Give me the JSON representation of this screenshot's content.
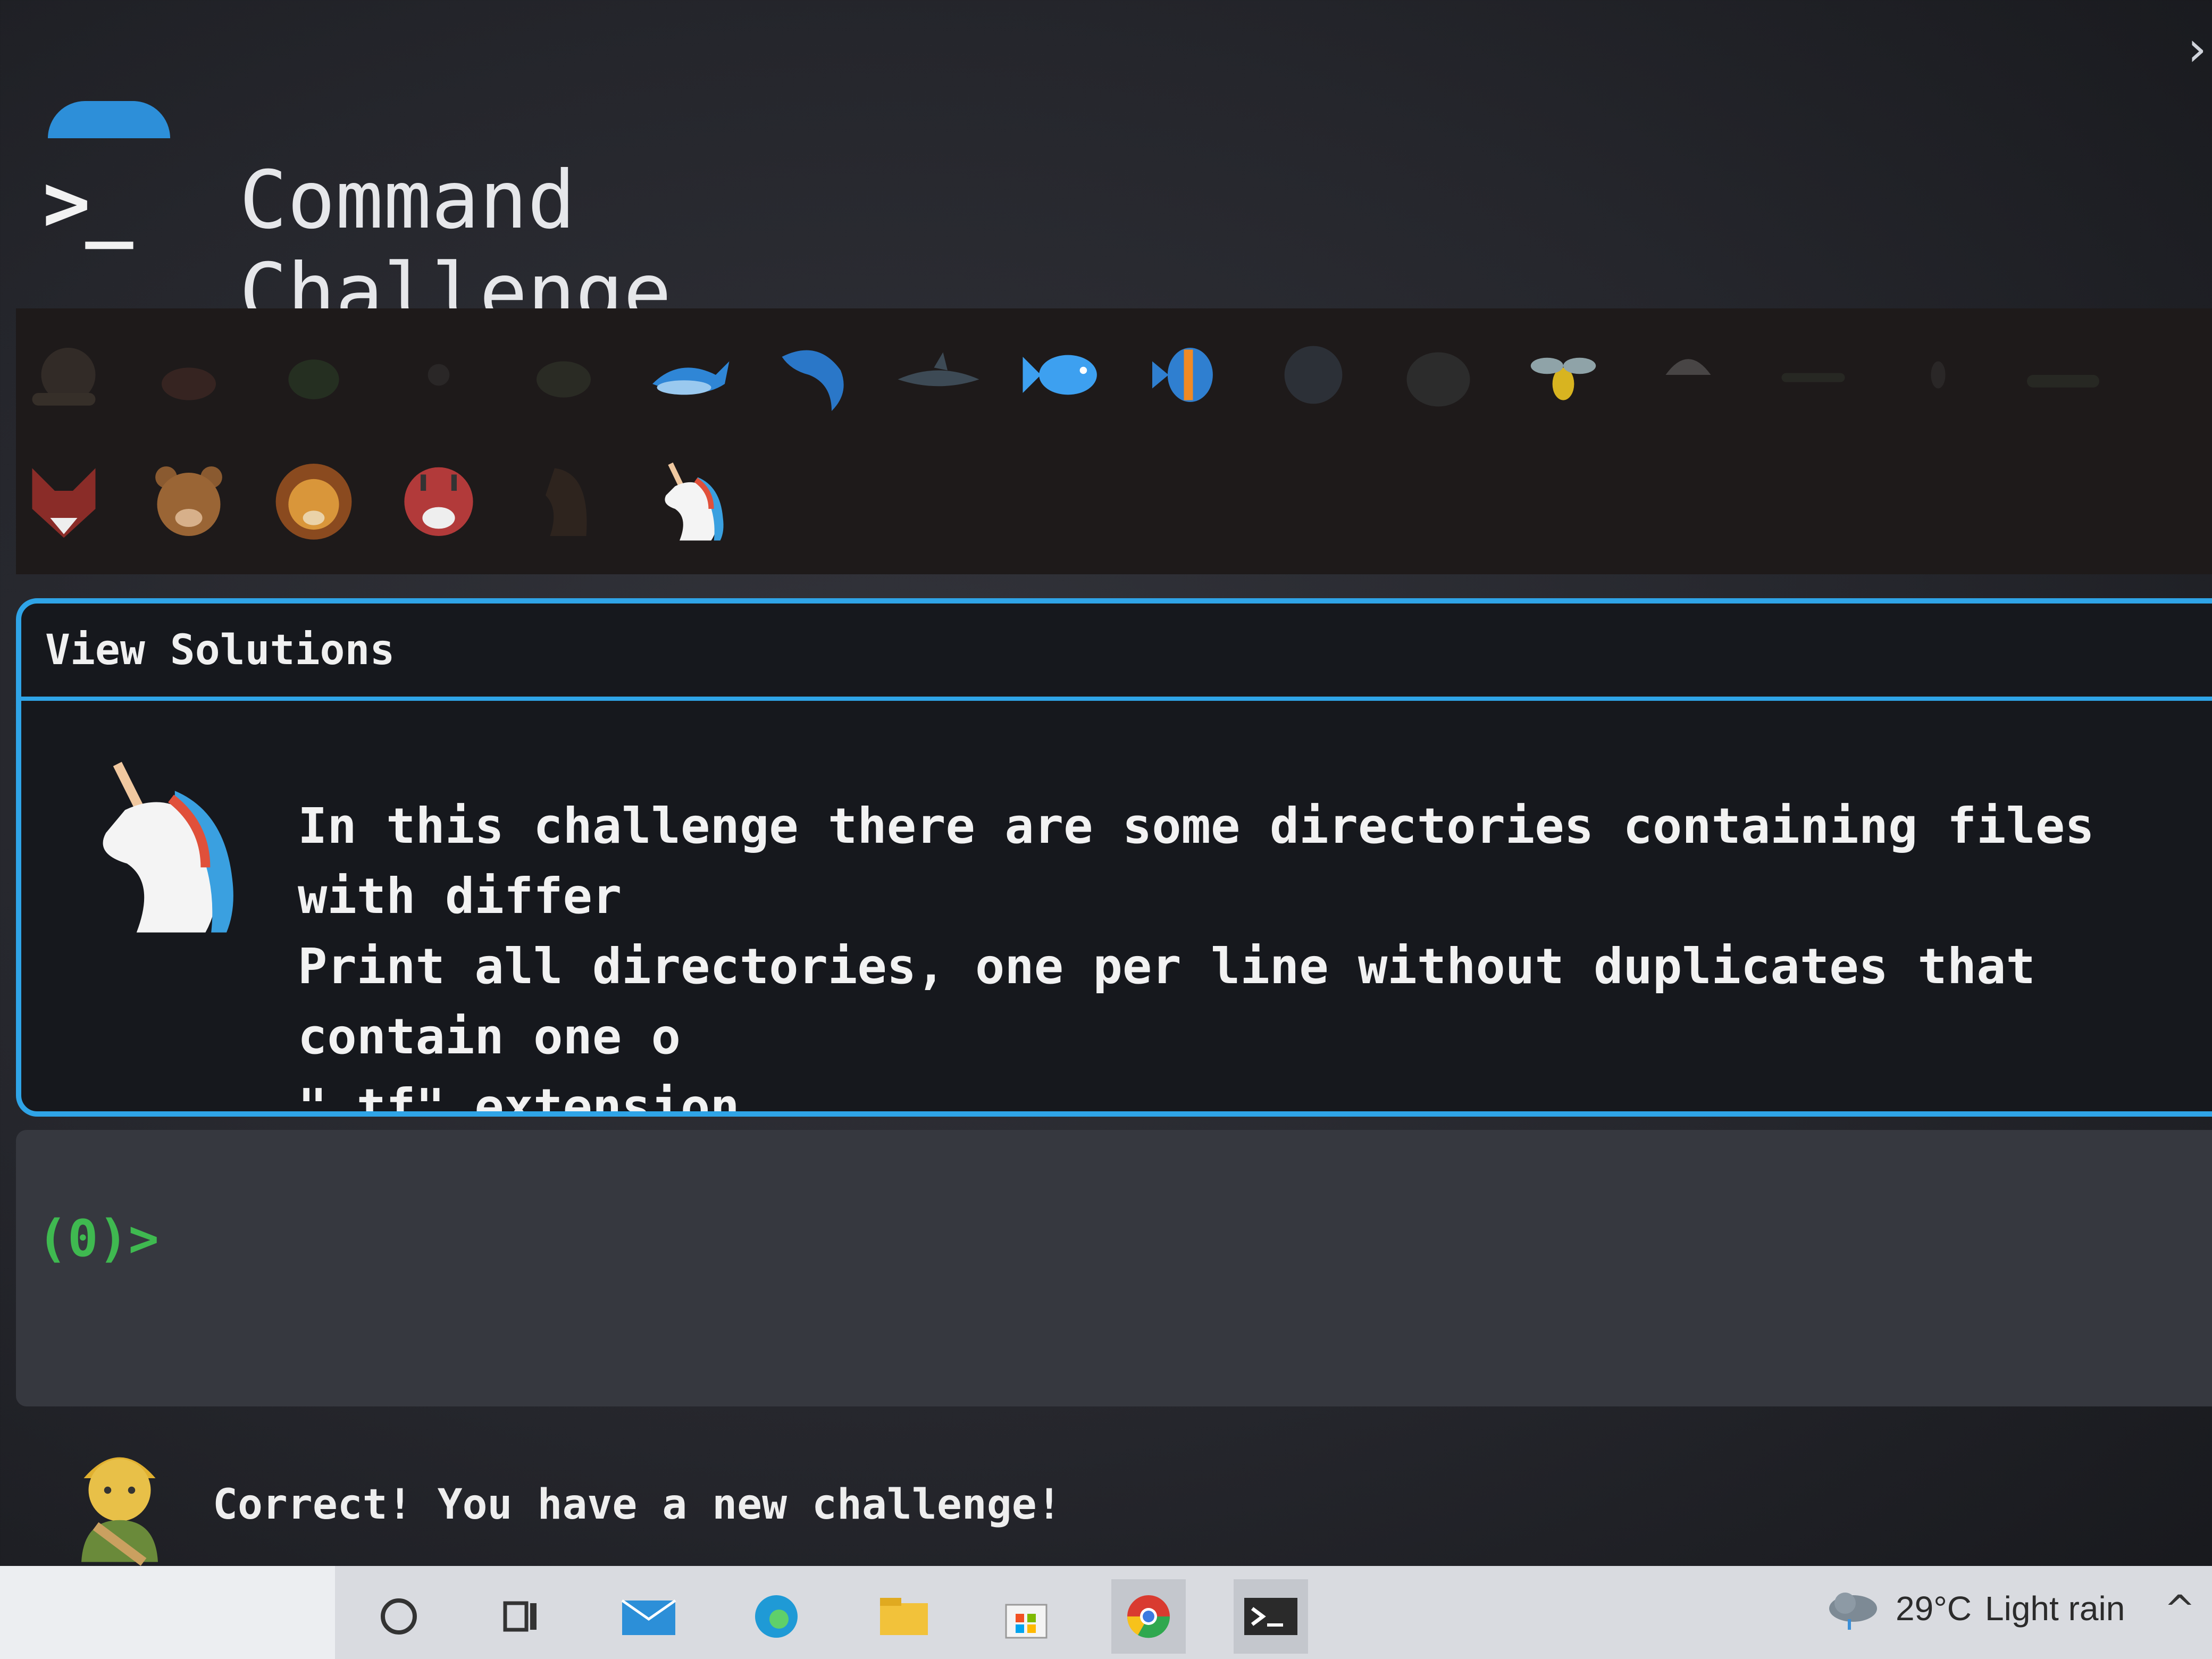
{
  "window": {
    "close_glyph": "›"
  },
  "header": {
    "logo_glyph": ">_",
    "title": "Command Challenge"
  },
  "emoji_strip": {
    "row1": [
      "snail",
      "crab",
      "frog",
      "ant",
      "turtle",
      "whale",
      "dolphin",
      "shark",
      "fish",
      "tropical-fish",
      "blowfish",
      "seal",
      "bee",
      "mushroom",
      "lizard",
      "bug",
      "crocodile"
    ],
    "row2": [
      "fox",
      "bear",
      "lion",
      "tiger",
      "horse",
      "unicorn"
    ],
    "completed_count_row1": 8,
    "completed_count_row2": 5
  },
  "panel": {
    "view_solutions": "View Solutions",
    "challenge_text": "In this challenge there are some directories containing files with differ\nPrint all directories, one per line without duplicates that contain one o\n\".tf\" extension."
  },
  "terminal": {
    "prompt": "(0)>",
    "input_value": ""
  },
  "feedback": {
    "message": "Correct! You have a new challenge!"
  },
  "taskbar": {
    "weather_temp": "29°C",
    "weather_desc": "Light rain",
    "overflow_glyph": "^",
    "icons": [
      "search-icon",
      "cortana-icon",
      "task-view-icon",
      "mail-icon",
      "edge-icon",
      "file-explorer-icon",
      "store-icon",
      "chrome-icon",
      "terminal-icon"
    ]
  },
  "colors": {
    "accent": "#2fa4e7",
    "prompt": "#3fb950",
    "panel_bg": "#16181d",
    "terminal_bg": "#36383f"
  }
}
